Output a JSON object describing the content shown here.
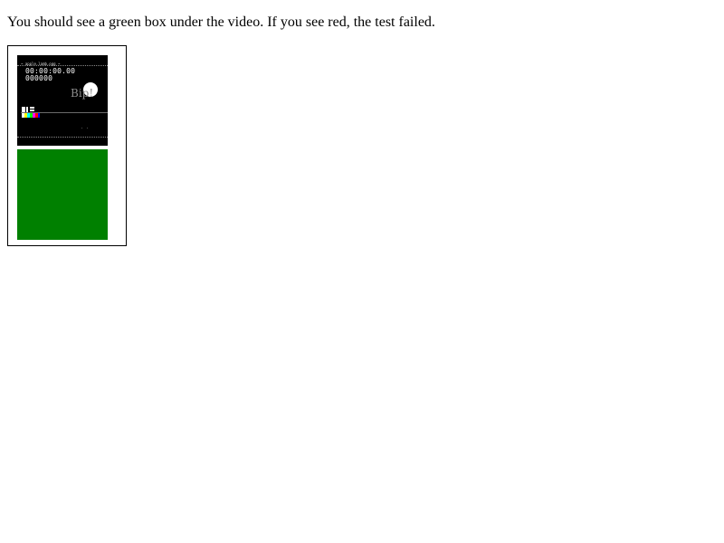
{
  "instruction": "You should see a green box under the video. If you see red, the test failed.",
  "video": {
    "title_line": "~ apple.lamb.ogg ~",
    "timecode": "00:00:00.00",
    "frame_count": "000000",
    "caption": "Bip!",
    "dots": ". ."
  },
  "colors": {
    "result_box": "#008000",
    "video_background": "#000000"
  }
}
